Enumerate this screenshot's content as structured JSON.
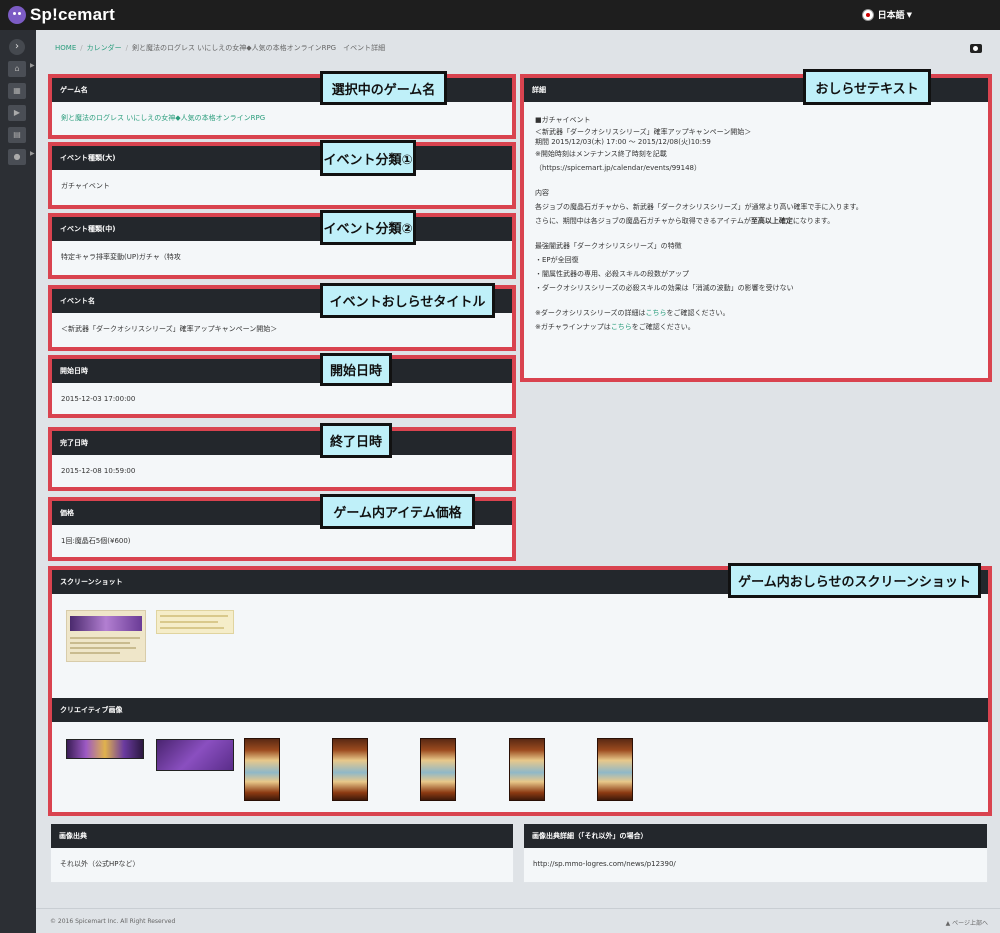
{
  "app": {
    "logo": "Sp!cemart",
    "language": "日本語"
  },
  "breadcrumb": {
    "home": "HOME",
    "calendar": "カレンダー",
    "current": "剣と魔法のログレス いにしえの女神◆人気の本格オンラインRPG　イベント詳細"
  },
  "fields": {
    "game_name": {
      "label": "ゲーム名",
      "value": "剣と魔法のログレス いにしえの女神◆人気の本格オンラインRPG"
    },
    "event_type_major": {
      "label": "イベント種類(大)",
      "value": "ガチャイベント"
    },
    "event_type_mid": {
      "label": "イベント種類(中)",
      "value": "特定キャラ排率変動(UP)ガチャ（特攻"
    },
    "event_name": {
      "label": "イベント名",
      "value": "＜新武器「ダークオシリスシリーズ」確率アップキャンペーン開始＞"
    },
    "start": {
      "label": "開始日時",
      "value": "2015-12-03 17:00:00"
    },
    "end": {
      "label": "完了日時",
      "value": "2015-12-08 10:59:00"
    },
    "price": {
      "label": "価格",
      "value": "1回:魔晶石5個(¥600)"
    }
  },
  "detail": {
    "label": "詳細",
    "lines": [
      "■ガチャイベント",
      "＜新武器「ダークオシリスシリーズ」確率アップキャンペーン開始＞",
      "期間 2015/12/03(木) 17:00 〜 2015/12/08(火)10:59",
      "※開始時刻はメンテナンス終了時刻を記載",
      "（https://spicemart.jp/calendar/events/99148）",
      "内容",
      "各ジョブの魔晶石ガチャから、新武器「ダークオシリスシリーズ」が通常より高い確率で手に入ります。",
      "さらに、期間中は各ジョブの魔晶石ガチャから取得できるアイテムが",
      "至高以上確定",
      "になります。",
      "最強闇武器「ダークオシリスシリーズ」の特徴",
      "・EPが全回復",
      "・闇属性武器の専用、必殺スキルの段数がアップ",
      "・ダークオシリスシリーズの必殺スキルの効果は「消滅の波動」の影響を受けない",
      "※ダークオシリスシリーズの詳細は",
      "こちら",
      "をご確認ください。",
      "※ガチャラインナップは",
      "をご確認ください。"
    ]
  },
  "screenshots": {
    "label": "スクリーンショット"
  },
  "creatives": {
    "label": "クリエイティブ画像"
  },
  "image_source": {
    "label": "画像出典",
    "value": "それ以外（公式HPなど）"
  },
  "image_source_detail": {
    "label": "画像出典詳細（「それ以外」の場合）",
    "value": "http://sp.mmo-logres.com/news/p12390/"
  },
  "callouts": {
    "game_name": "選択中のゲーム名",
    "event_type_1": "イベント分類①",
    "event_type_2": "イベント分類②",
    "event_title": "イベントおしらせタイトル",
    "start": "開始日時",
    "end": "終了日時",
    "price": "ゲーム内アイテム価格",
    "notice_text": "おしらせテキスト",
    "screenshot": "ゲーム内おしらせのスクリーンショット"
  },
  "footer": {
    "copyright": "© 2016 Spicemart Inc. All Right Reserved",
    "back_to_top": "ページ上部へ"
  },
  "colors": {
    "highlight_border": "#d9434f",
    "callout_bg": "#bff0f9",
    "link": "#2a9d7c",
    "header_dark": "#23272c"
  }
}
